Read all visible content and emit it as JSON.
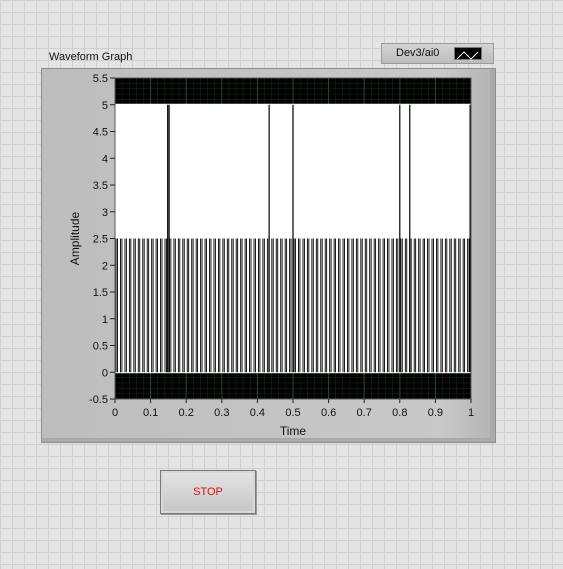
{
  "graph": {
    "title": "Waveform Graph",
    "legend_label": "Dev3/ai0"
  },
  "chart_data": {
    "type": "line",
    "title": "Waveform Graph",
    "xlabel": "Time",
    "ylabel": "Amplitude",
    "xlim": [
      0,
      1
    ],
    "ylim": [
      -0.5,
      5.5
    ],
    "x_ticks": [
      "0",
      "0.1",
      "0.2",
      "0.3",
      "0.4",
      "0.5",
      "0.6",
      "0.7",
      "0.8",
      "0.9",
      "1"
    ],
    "y_ticks": [
      "-0.5",
      "0",
      "0.5",
      "1",
      "1.5",
      "2",
      "2.5",
      "3",
      "3.5",
      "4",
      "4.5",
      "5",
      "5.5"
    ],
    "grid": true,
    "plot_background": "#000000",
    "series": [
      {
        "name": "Dev3/ai0",
        "color": "#ffffff",
        "description_values": {
          "low_level": 0,
          "high_level": 5,
          "mid_spike_level": 2.5,
          "mid_spike_period": 0.0125,
          "full_spike_x": [
            0.148,
            0.152,
            0.433,
            0.5,
            0.8,
            0.828
          ]
        }
      }
    ]
  },
  "stop_button": {
    "label": "STOP",
    "color": "#e01010"
  }
}
